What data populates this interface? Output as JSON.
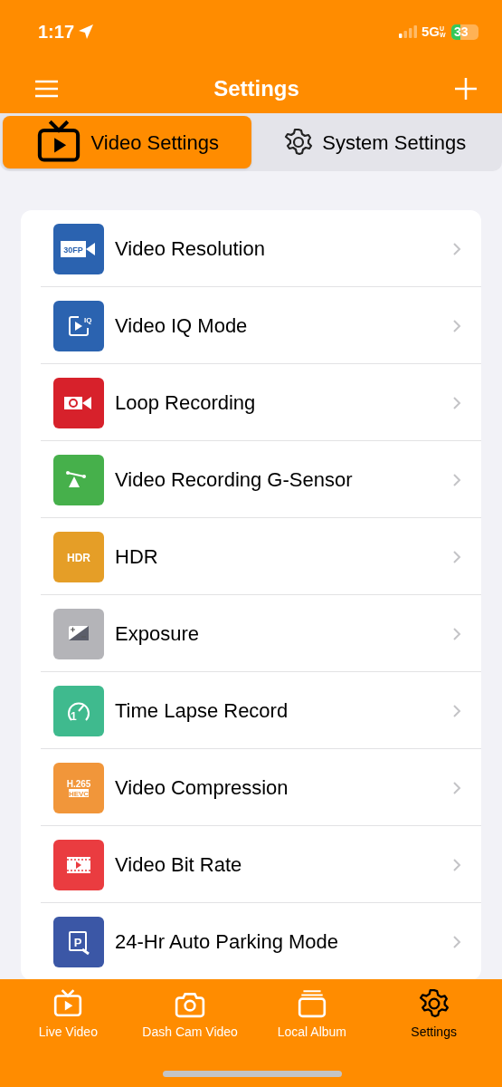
{
  "status_bar": {
    "time": "1:17",
    "network": "5G",
    "network_sub": "UW",
    "battery": "33"
  },
  "header": {
    "title": "Settings"
  },
  "tabs": [
    {
      "label": "Video Settings",
      "kind": "tv",
      "selected": true
    },
    {
      "label": "System Settings",
      "kind": "gear",
      "selected": false
    }
  ],
  "settings": [
    {
      "label": "Video Resolution",
      "kind": "resolution",
      "color": "#2b63b0",
      "badge": "30FP"
    },
    {
      "label": "Video IQ Mode",
      "kind": "iq",
      "color": "#2b63b0",
      "badge": "IQ"
    },
    {
      "label": "Loop Recording",
      "kind": "loop",
      "color": "#d7212b"
    },
    {
      "label": "Video Recording G-Sensor",
      "kind": "gsensor",
      "color": "#46b04b"
    },
    {
      "label": "HDR",
      "kind": "hdr",
      "color": "#e59e27",
      "badge": "HDR"
    },
    {
      "label": "Exposure",
      "kind": "exposure",
      "color": "#b4b4b8"
    },
    {
      "label": "Time Lapse Record",
      "kind": "timelapse",
      "color": "#3fba8e",
      "badge": "1"
    },
    {
      "label": "Video Compression",
      "kind": "compression",
      "color": "#f1963a",
      "badge": "H.265",
      "badge2": "HEVC"
    },
    {
      "label": "Video Bit Rate",
      "kind": "bitrate",
      "color": "#ea3c40"
    },
    {
      "label": "24-Hr Auto Parking Mode",
      "kind": "parking",
      "color": "#3b57a6",
      "badge": "P"
    }
  ],
  "bottom_nav": [
    {
      "label": "Live Video",
      "kind": "tv",
      "selected": false
    },
    {
      "label": "Dash Cam Video",
      "kind": "camera",
      "selected": false
    },
    {
      "label": "Local Album",
      "kind": "album",
      "selected": false
    },
    {
      "label": "Settings",
      "kind": "gear",
      "selected": true
    }
  ]
}
